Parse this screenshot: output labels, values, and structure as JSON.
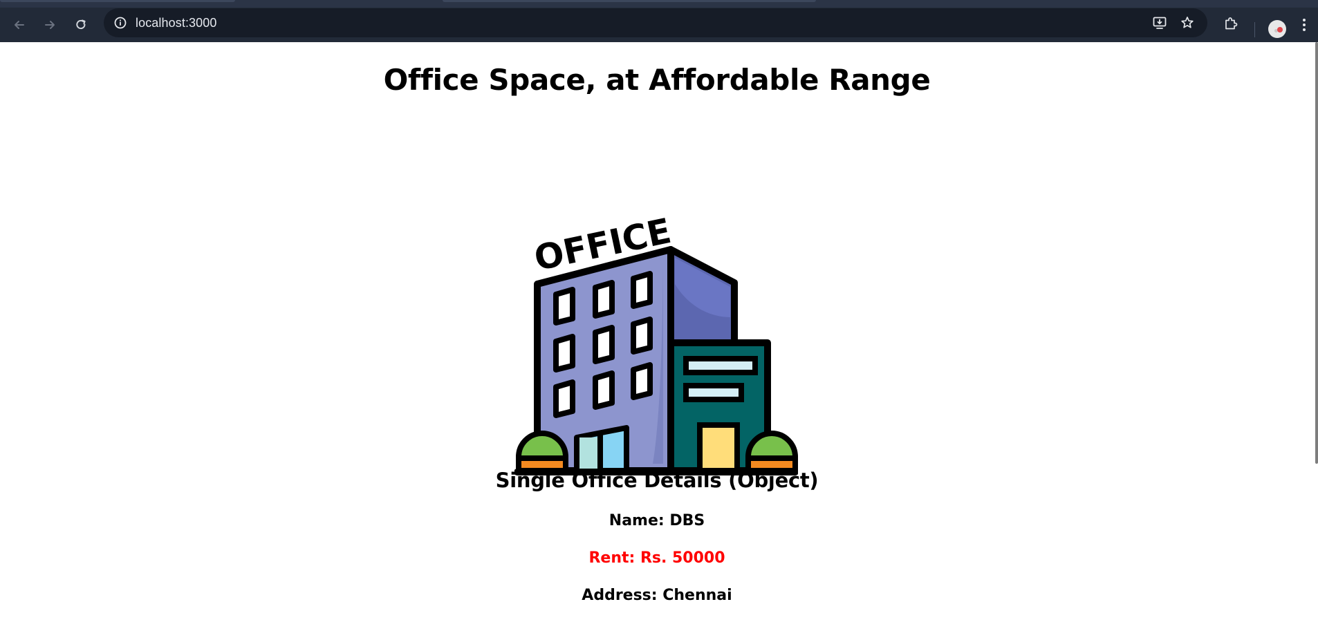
{
  "browser": {
    "address_bar": {
      "url": "localhost:3000"
    },
    "icons": {
      "back": "back-arrow-icon",
      "forward": "forward-arrow-icon",
      "reload": "reload-icon",
      "site_info": "info-icon",
      "install": "install-app-icon",
      "bookmark": "star-icon",
      "extensions": "puzzle-icon",
      "profile": "avatar",
      "menu": "kebab-menu-icon"
    }
  },
  "page": {
    "title": "Office Space, at Affordable Range",
    "image": {
      "sign_text": "OFFICE",
      "icon": "office-building-illustration"
    },
    "section_title": "Single Office Details (Object)",
    "details": {
      "name": "Name: DBS",
      "rent": "Rent: Rs. 50000",
      "address": "Address: Chennai"
    },
    "colors": {
      "rent_text": "#ff0000",
      "text": "#000000",
      "background": "#ffffff"
    }
  }
}
